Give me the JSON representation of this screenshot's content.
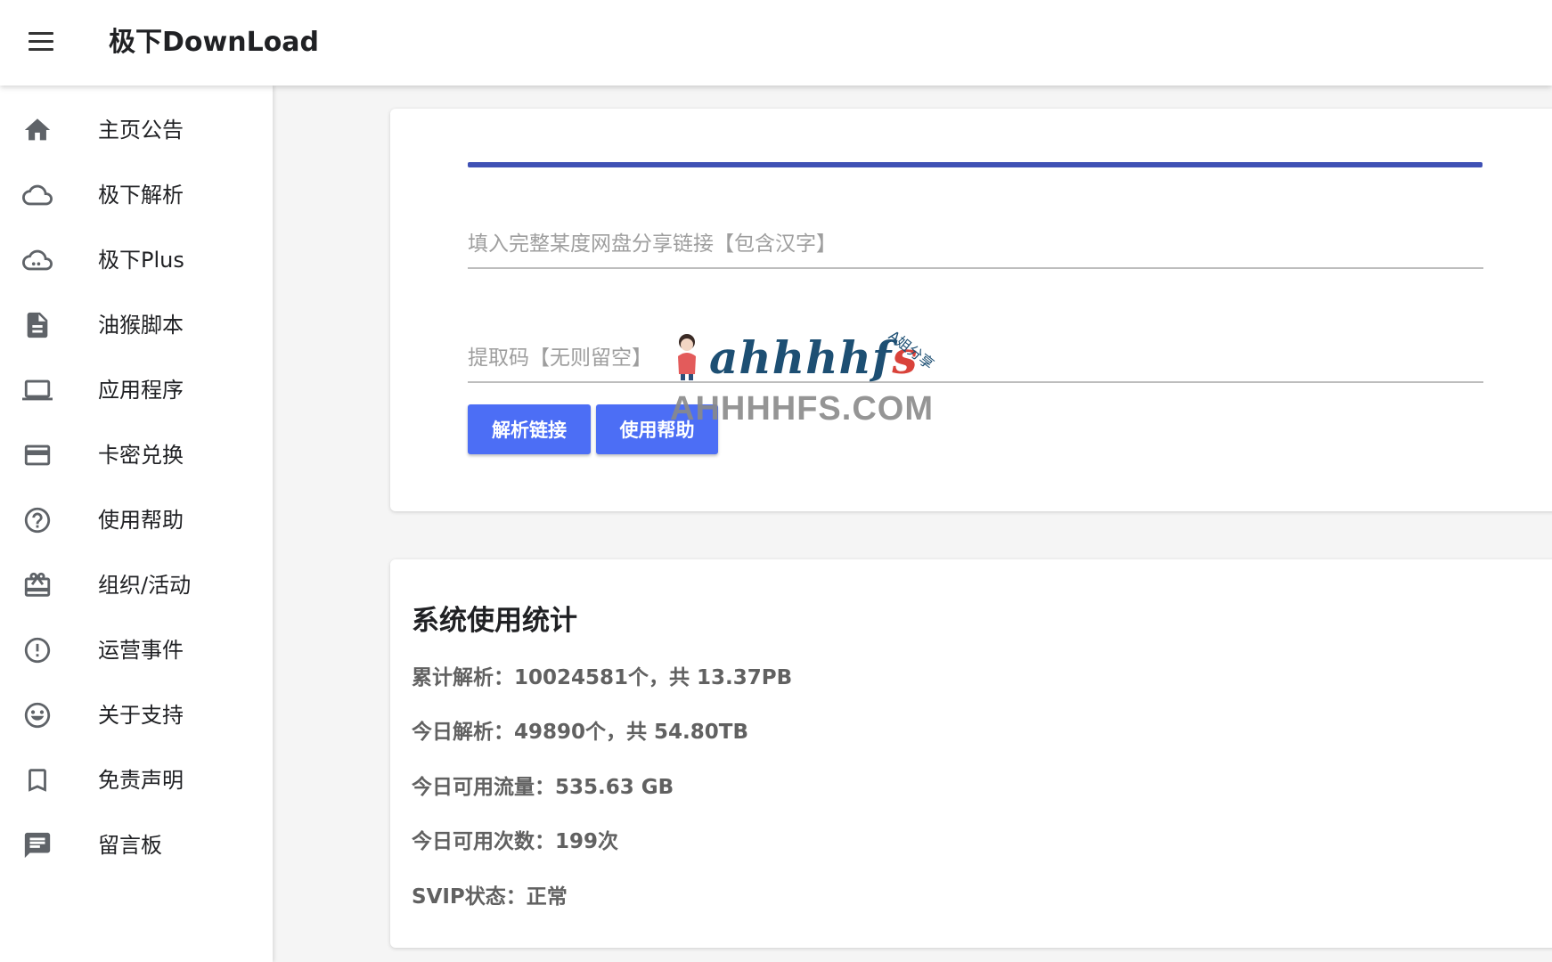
{
  "header": {
    "title": "极下DownLoad",
    "menu_icon": "menu-icon"
  },
  "sidebar": {
    "items": [
      {
        "label": "主页公告",
        "icon": "home-icon"
      },
      {
        "label": "极下解析",
        "icon": "cloud-outline-icon"
      },
      {
        "label": "极下Plus",
        "icon": "cloud-queue-icon"
      },
      {
        "label": "油猴脚本",
        "icon": "document-icon"
      },
      {
        "label": "应用程序",
        "icon": "laptop-icon"
      },
      {
        "label": "卡密兑换",
        "icon": "credit-card-icon"
      },
      {
        "label": "使用帮助",
        "icon": "help-circle-icon"
      },
      {
        "label": "组织/活动",
        "icon": "gift-card-icon"
      },
      {
        "label": "运营事件",
        "icon": "alert-circle-icon"
      },
      {
        "label": "关于支持",
        "icon": "smiley-icon"
      },
      {
        "label": "免责声明",
        "icon": "bookmark-icon"
      },
      {
        "label": "留言板",
        "icon": "message-icon"
      }
    ]
  },
  "form": {
    "progress": 1.0,
    "link_field": {
      "value": "",
      "placeholder": "填入完整某度网盘分享链接【包含汉字】"
    },
    "code_field": {
      "value": "",
      "placeholder": "提取码【无则留空】"
    },
    "parse_button": "解析链接",
    "help_button": "使用帮助"
  },
  "watermark": {
    "script_text": "ahhhhf",
    "script_last": "s",
    "tag": "A姐分享",
    "domain": "AHHHHFS.COM"
  },
  "stats": {
    "title": "系统使用统计",
    "lines": [
      "累计解析：10024581个，共 13.37PB",
      "今日解析：49890个，共 54.80TB",
      "今日可用流量：535.63 GB",
      "今日可用次数：199次",
      "SVIP状态：正常"
    ]
  },
  "colors": {
    "accent": "#3f51b5",
    "button": "#4c6ef5",
    "icon": "#5f6368"
  }
}
